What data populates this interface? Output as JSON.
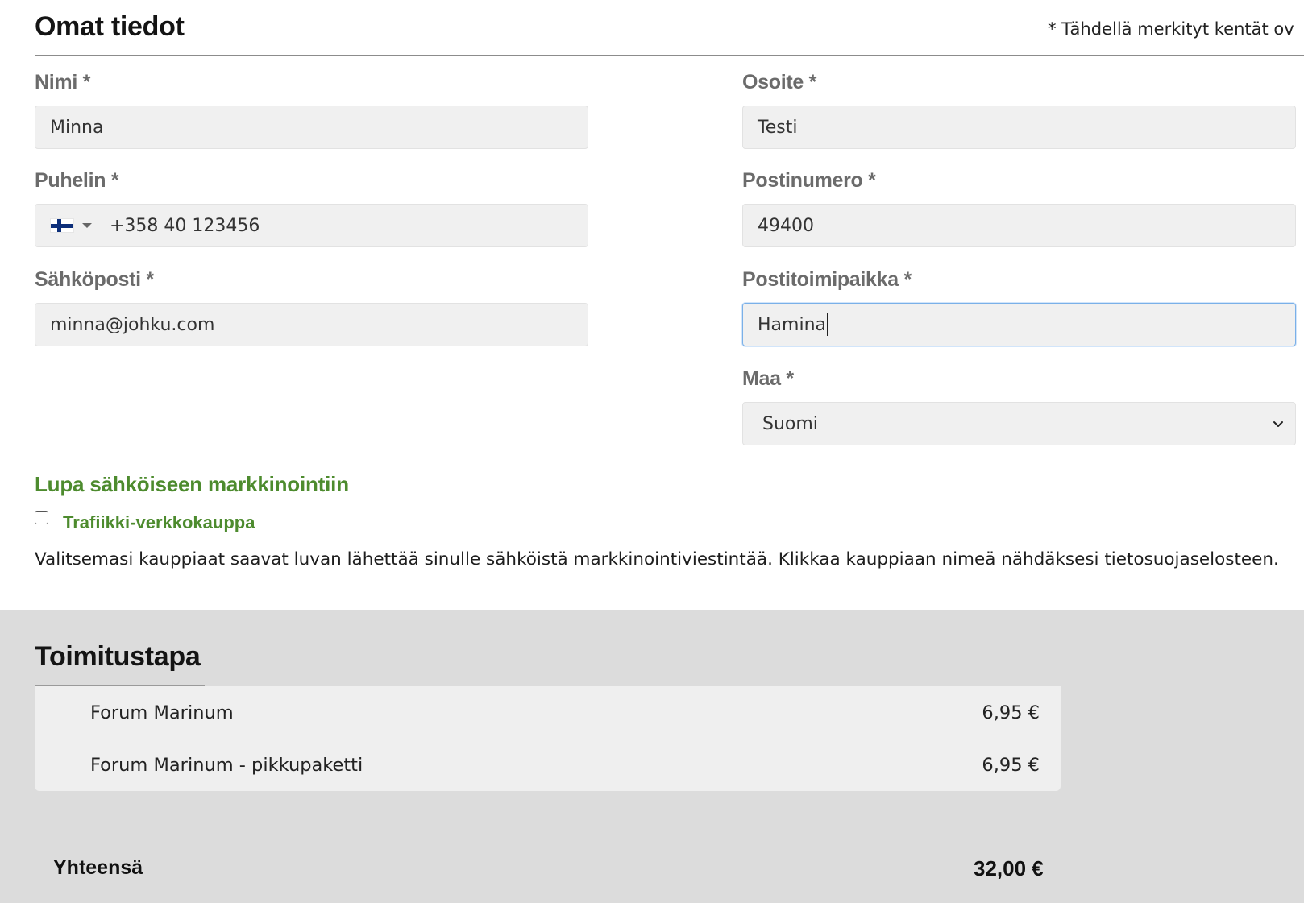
{
  "personal": {
    "title": "Omat tiedot",
    "required_note": "* Tähdellä merkityt kentät ov",
    "fields": {
      "name": {
        "label": "Nimi *",
        "value": "Minna"
      },
      "phone": {
        "label": "Puhelin *",
        "value": "+358 40 123456",
        "country_flag": "finland-flag-icon"
      },
      "email": {
        "label": "Sähköposti *",
        "value": "minna@johku.com"
      },
      "address": {
        "label": "Osoite *",
        "value": "Testi"
      },
      "postal_code": {
        "label": "Postinumero *",
        "value": "49400"
      },
      "city": {
        "label": "Postitoimipaikka *",
        "value": "Hamina"
      },
      "country": {
        "label": "Maa *",
        "value": "Suomi"
      }
    }
  },
  "marketing": {
    "heading": "Lupa sähköiseen markkinointiin",
    "checkbox_label": "Trafiikki-verkkokauppa",
    "checkbox_checked": false,
    "info": "Valitsemasi kauppiaat saavat luvan lähettää sinulle sähköistä markkinointiviestintää. Klikkaa kauppiaan nimeä nähdäksesi tietosuojaselosteen."
  },
  "shipping": {
    "title": "Toimitustapa",
    "options": [
      {
        "name": "Forum Marinum",
        "price": "6,95 €"
      },
      {
        "name": "Forum Marinum - pikkupaketti",
        "price": "6,95 €"
      }
    ]
  },
  "total": {
    "label": "Yhteensä",
    "value": "32,00 €"
  },
  "colors": {
    "accent_green": "#4d8b2e",
    "input_bg": "#f0f0f0",
    "section_gray": "#dcdcdc",
    "focus_border": "#7ab0e8"
  }
}
